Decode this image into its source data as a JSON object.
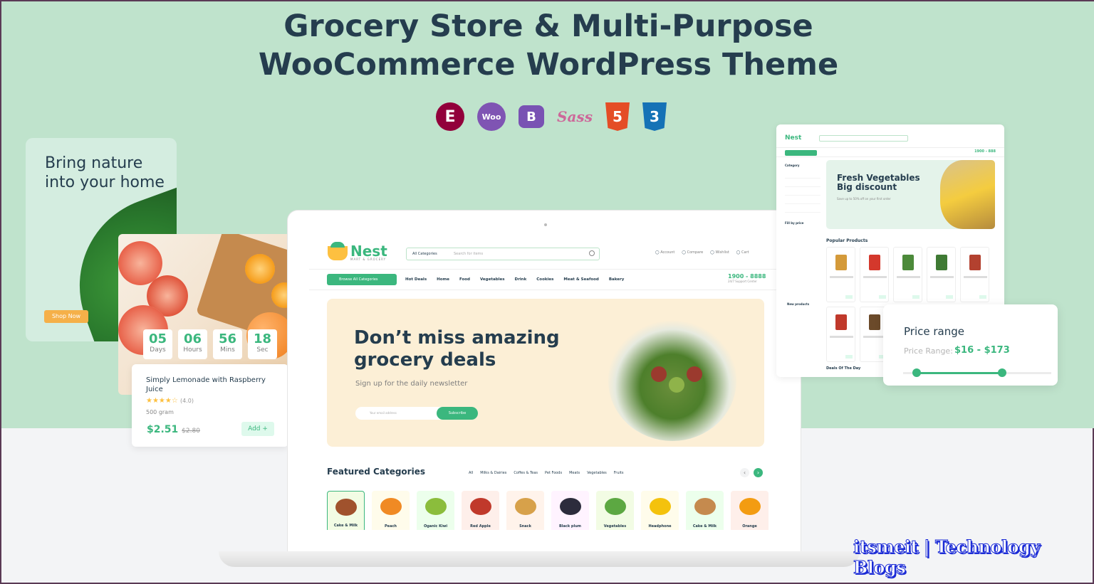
{
  "banner": {
    "title_line1": "Grocery Store & Multi-Purpose",
    "title_line2": "WooCommerce WordPress Theme"
  },
  "tech_icons": [
    {
      "name": "elementor-icon",
      "glyph": "E"
    },
    {
      "name": "woocommerce-icon",
      "glyph": "Woo"
    },
    {
      "name": "bootstrap-icon",
      "glyph": "B"
    },
    {
      "name": "sass-icon",
      "glyph": "Sass"
    },
    {
      "name": "html5-icon",
      "glyph": "5"
    },
    {
      "name": "css3-icon",
      "glyph": "3"
    }
  ],
  "nature_card": {
    "title": "Bring nature into your home",
    "button": "Shop Now"
  },
  "countdown": [
    {
      "value": "05",
      "label": "Days"
    },
    {
      "value": "06",
      "label": "Hours"
    },
    {
      "value": "56",
      "label": "Mins"
    },
    {
      "value": "18",
      "label": "Sec"
    }
  ],
  "product": {
    "name": "Simply Lemonade with Raspberry Juice",
    "stars": "★★★★",
    "rating": "(4.0)",
    "weight": "500 gram",
    "price": "$2.51",
    "old_price": "$2.80",
    "add": "Add +"
  },
  "header": {
    "logo": "Nest",
    "logo_sub": "MART & GROCERY",
    "category_select": "All Categories",
    "search_placeholder": "Search for items",
    "actions": [
      "Account",
      "Compare",
      "Wishlist",
      "Cart"
    ]
  },
  "nav": {
    "browse": "Browse All Categories",
    "items": [
      "Hot Deals",
      "Home",
      "Food",
      "Vegetables",
      "Drink",
      "Cookies",
      "Meat & Seafood",
      "Bakery"
    ],
    "phone": "1900 - 8888",
    "phone_sub": "24/7 Support Center"
  },
  "hero": {
    "headline": "Don’t miss amazing grocery deals",
    "subtitle": "Sign up for the daily newsletter",
    "email_placeholder": "Your email address",
    "subscribe": "Subscribe"
  },
  "featured": {
    "title": "Featured Categories",
    "tabs": [
      "All",
      "Milks & Dairies",
      "Coffes & Teas",
      "Pet Foods",
      "Meats",
      "Vegetables",
      "Fruits"
    ],
    "categories": [
      {
        "label": "Cake & Milk",
        "color": "#a0522d"
      },
      {
        "label": "Peach",
        "color": "#f08a24"
      },
      {
        "label": "Oganic Kiwi",
        "color": "#8bbd3c"
      },
      {
        "label": "Red Apple",
        "color": "#c0392b"
      },
      {
        "label": "Snack",
        "color": "#d7a14a"
      },
      {
        "label": "Black plum",
        "color": "#2c2c3c"
      },
      {
        "label": "Vegetables",
        "color": "#5ca842"
      },
      {
        "label": "Headphone",
        "color": "#f4c20d"
      },
      {
        "label": "Cake & Milk",
        "color": "#c58a4e"
      },
      {
        "label": "Orange",
        "color": "#f39c12"
      }
    ]
  },
  "side_shot": {
    "logo": "Nest",
    "phone": "1900 - 888",
    "category": "Category",
    "fill_price": "Fill by price",
    "new_products": "New products",
    "hero_title": "Fresh Vegetables Big discount",
    "hero_sub": "Save up to 50% off on your first order",
    "popular": "Popular Products",
    "deals": "Deals Of The Day"
  },
  "price_range": {
    "title": "Price range",
    "label": "Price Range:",
    "value": "$16 - $173",
    "low_fraction": 0.09,
    "high_fraction": 0.67
  },
  "watermark": "itsmeit | Technology Blogs",
  "colors": {
    "brand_green": "#3bb77e",
    "heading": "#253d4e",
    "background_green": "#bfe3cc"
  }
}
